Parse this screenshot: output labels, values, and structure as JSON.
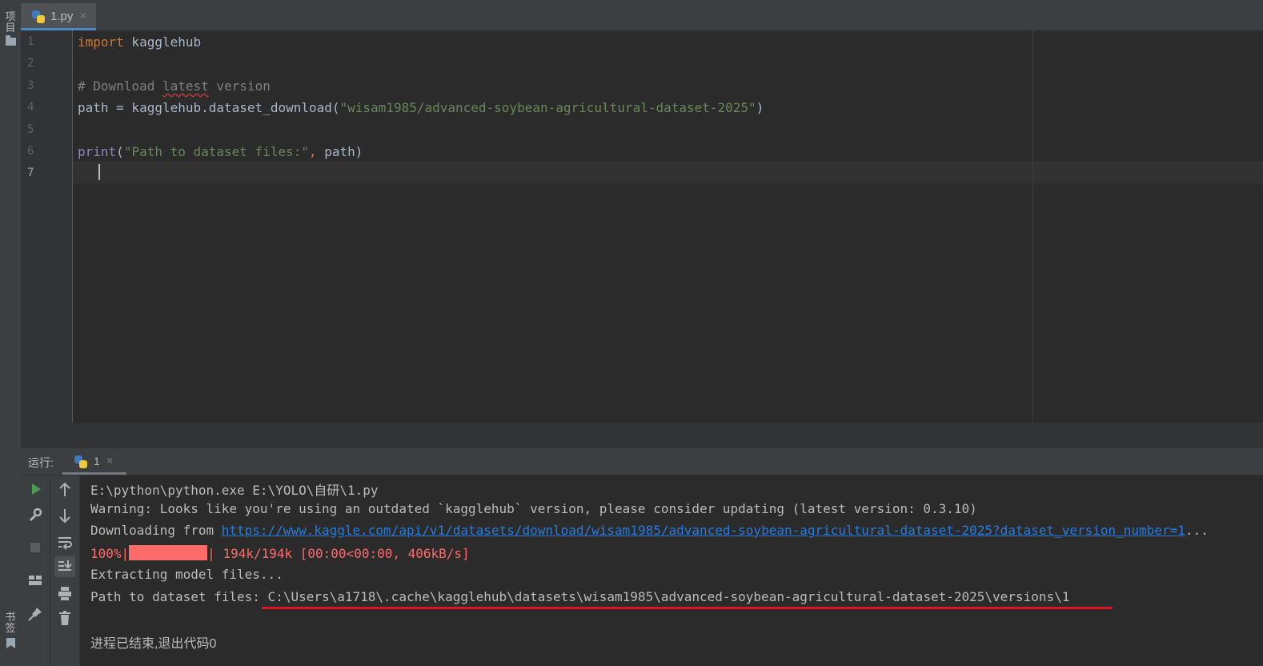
{
  "left_strip": {
    "project_label": "项目",
    "bookmarks_label": "书签"
  },
  "tab": {
    "label": "1.py",
    "close": "×"
  },
  "editor": {
    "line_numbers": [
      "1",
      "2",
      "3",
      "4",
      "5",
      "6",
      "7"
    ],
    "lines": {
      "l1_kw": "import",
      "l1_rest": " kagglehub",
      "l3_a": "# Download ",
      "l3_b": "latest",
      "l3_c": " version",
      "l4_a": "path = kagglehub.dataset_download(",
      "l4_str": "\"wisam1985/advanced-soybean-agricultural-dataset-2025\"",
      "l4_c": ")",
      "l6_fn": "print",
      "l6_a": "(",
      "l6_str": "\"Path to dataset files:\"",
      "l6_comma": ",",
      "l6_b": " path)"
    }
  },
  "run_panel": {
    "title": "运行:",
    "tab_label": "1",
    "tab_close": "×",
    "console": {
      "cmd": "E:\\python\\python.exe E:\\YOLO\\自研\\1.py",
      "warning": "Warning: Looks like you're using an outdated `kagglehub` version, please consider updating (latest version: 0.3.10)",
      "downloading_prefix": "Downloading from ",
      "download_url": "https://www.kaggle.com/api/v1/datasets/download/wisam1985/advanced-soybean-agricultural-dataset-2025?dataset_version_number=1",
      "download_ellipsis": "...",
      "progress_pct": "100%|",
      "progress_fraction": 1.0,
      "progress_rest": "| 194k/194k [00:00<00:00, 406kB/s]",
      "extracting": "Extracting model files...",
      "path_line": "Path to dataset files: C:\\Users\\a1718\\.cache\\kagglehub\\datasets\\wisam1985\\advanced-soybean-agricultural-dataset-2025\\versions\\1",
      "exit": "进程已结束,退出代码0"
    }
  },
  "icons": [
    "python-file-icon",
    "folder-icon",
    "bookmark-icon",
    "run-icon",
    "wrench-icon",
    "stop-icon",
    "layout-icon",
    "pin-icon",
    "up-arrow-icon",
    "down-arrow-icon",
    "soft-wrap-icon",
    "scroll-to-end-icon",
    "print-icon",
    "trash-icon"
  ],
  "colors": {
    "keyword": "#cc7832",
    "string": "#6a8759",
    "comment": "#808080",
    "builtin": "#8888c6",
    "link": "#287bde",
    "stderr": "#ff6b68",
    "annotation_underline": "#e0141e",
    "tab_accent": "#4a88c7"
  }
}
